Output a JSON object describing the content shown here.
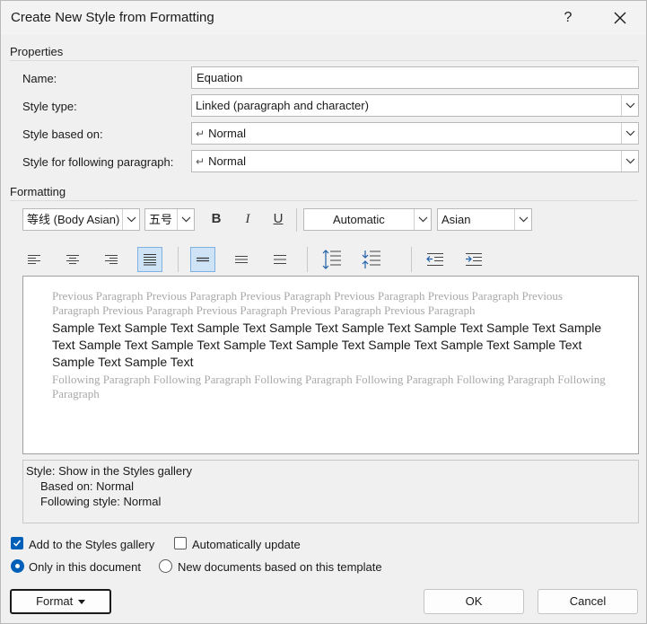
{
  "dialog": {
    "title": "Create New Style from Formatting",
    "help_label": "?"
  },
  "properties": {
    "group_label": "Properties",
    "name_label": "Name:",
    "name_value": "Equation",
    "style_type_label": "Style type:",
    "style_type_value": "Linked (paragraph and character)",
    "based_on_label": "Style based on:",
    "based_on_value": "Normal",
    "following_label": "Style for following paragraph:",
    "following_value": "Normal"
  },
  "formatting": {
    "group_label": "Formatting",
    "font": "等线 (Body Asian)",
    "size": "五号",
    "bold": "B",
    "italic": "I",
    "underline": "U",
    "color": "Automatic",
    "script": "Asian",
    "selected_alignment": "justify",
    "selected_spacing": "single"
  },
  "preview": {
    "previous_text": "Previous Paragraph Previous Paragraph Previous Paragraph Previous Paragraph Previous Paragraph Previous Paragraph Previous Paragraph Previous Paragraph Previous Paragraph Previous Paragraph",
    "sample_text": "Sample Text Sample Text Sample Text Sample Text Sample Text Sample Text Sample Text Sample Text Sample Text Sample Text Sample Text Sample Text Sample Text Sample Text Sample Text Sample Text Sample Text",
    "following_text": "Following Paragraph Following Paragraph Following Paragraph Following Paragraph Following Paragraph Following Paragraph"
  },
  "description": {
    "line1": "Style: Show in the Styles gallery",
    "line2": "Based on: Normal",
    "line3": "Following style: Normal"
  },
  "options": {
    "add_to_gallery_label": "Add to the Styles gallery",
    "add_to_gallery_checked": true,
    "auto_update_label": "Automatically update",
    "auto_update_checked": false,
    "only_doc_label": "Only in this document",
    "new_docs_label": "New documents based on this template",
    "selected_scope": "only_doc"
  },
  "buttons": {
    "format": "Format",
    "ok": "OK",
    "cancel": "Cancel"
  },
  "colors": {
    "accent": "#005fb8",
    "selected_button_bg": "#cfe3f7",
    "preview_gray_text": "#a8a8a8"
  }
}
